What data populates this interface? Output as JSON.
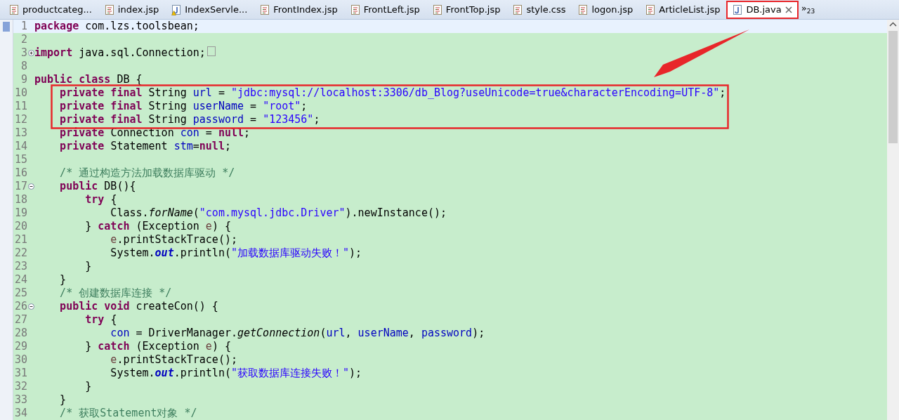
{
  "tabs": [
    {
      "label": "productcateg...",
      "kind": "jsp",
      "warning": false,
      "selected": false
    },
    {
      "label": "index.jsp",
      "kind": "jsp",
      "warning": false,
      "selected": false
    },
    {
      "label": "IndexServle...",
      "kind": "java",
      "warning": true,
      "selected": false
    },
    {
      "label": "FrontIndex.jsp",
      "kind": "jsp",
      "warning": false,
      "selected": false
    },
    {
      "label": "FrontLeft.jsp",
      "kind": "jsp",
      "warning": false,
      "selected": false
    },
    {
      "label": "FrontTop.jsp",
      "kind": "jsp",
      "warning": false,
      "selected": false
    },
    {
      "label": "style.css",
      "kind": "jsp",
      "warning": false,
      "selected": false
    },
    {
      "label": "logon.jsp",
      "kind": "jsp",
      "warning": false,
      "selected": false
    },
    {
      "label": "ArticleList.jsp",
      "kind": "jsp",
      "warning": false,
      "selected": false
    },
    {
      "label": "DB.java",
      "kind": "java",
      "warning": false,
      "selected": true
    }
  ],
  "overflow": {
    "symbol": "»",
    "count": "23"
  },
  "lines": [
    {
      "n": "1",
      "current": true,
      "tokens": [
        {
          "kind": "kw",
          "text": "package "
        },
        {
          "kind": "pl",
          "text": "com.lzs.toolsbean;"
        }
      ]
    },
    {
      "n": "2",
      "current": false
    },
    {
      "n": "3",
      "current": false,
      "folded": true,
      "tokens": [
        {
          "kind": "kw",
          "text": "import "
        },
        {
          "kind": "pl",
          "text": "java.sql.Connection;"
        }
      ]
    },
    {
      "n": "8",
      "current": false
    },
    {
      "n": "9",
      "current": false,
      "tokens": [
        {
          "kind": "kw",
          "text": "public class "
        },
        {
          "kind": "pl",
          "text": "DB {"
        }
      ]
    },
    {
      "n": "10",
      "current": false,
      "tokens": [
        {
          "kind": "kw",
          "text": "    private final "
        },
        {
          "kind": "pl",
          "text": "String "
        },
        {
          "kind": "fd",
          "text": "url"
        },
        {
          "kind": "pl",
          "text": " = "
        },
        {
          "kind": "st",
          "text": "\"jdbc:mysql://localhost:3306/db_Blog?useUnicode=true&characterEncoding=UTF-8\""
        },
        {
          "kind": "pl",
          "text": ";"
        }
      ]
    },
    {
      "n": "11",
      "current": false,
      "tokens": [
        {
          "kind": "kw",
          "text": "    private final "
        },
        {
          "kind": "pl",
          "text": "String "
        },
        {
          "kind": "fd",
          "text": "userName"
        },
        {
          "kind": "pl",
          "text": " = "
        },
        {
          "kind": "st",
          "text": "\"root\""
        },
        {
          "kind": "pl",
          "text": ";"
        }
      ]
    },
    {
      "n": "12",
      "current": false,
      "tokens": [
        {
          "kind": "kw",
          "text": "    private final "
        },
        {
          "kind": "pl",
          "text": "String "
        },
        {
          "kind": "fd",
          "text": "password"
        },
        {
          "kind": "pl",
          "text": " = "
        },
        {
          "kind": "st",
          "text": "\"123456\""
        },
        {
          "kind": "pl",
          "text": ";"
        }
      ]
    },
    {
      "n": "13",
      "current": false,
      "tokens": [
        {
          "kind": "kw",
          "text": "    private "
        },
        {
          "kind": "pl",
          "text": "Connection "
        },
        {
          "kind": "fd",
          "text": "con"
        },
        {
          "kind": "pl",
          "text": " = "
        },
        {
          "kind": "kw",
          "text": "null"
        },
        {
          "kind": "pl",
          "text": ";"
        }
      ]
    },
    {
      "n": "14",
      "current": false,
      "tokens": [
        {
          "kind": "kw",
          "text": "    private "
        },
        {
          "kind": "pl",
          "text": "Statement "
        },
        {
          "kind": "fd",
          "text": "stm"
        },
        {
          "kind": "pl",
          "text": "="
        },
        {
          "kind": "kw",
          "text": "null"
        },
        {
          "kind": "pl",
          "text": ";"
        }
      ]
    },
    {
      "n": "15",
      "current": false
    },
    {
      "n": "16",
      "current": false,
      "tokens": [
        {
          "kind": "cm",
          "text": "    /* 通过构造方法加载数据库驱动 */"
        }
      ]
    },
    {
      "n": "17",
      "current": false,
      "folded": false,
      "tokens": [
        {
          "kind": "kw",
          "text": "    public "
        },
        {
          "kind": "pl",
          "text": "DB(){"
        }
      ]
    },
    {
      "n": "18",
      "current": false,
      "tokens": [
        {
          "kind": "kw",
          "text": "        try "
        },
        {
          "kind": "pl",
          "text": "{"
        }
      ]
    },
    {
      "n": "19",
      "current": false,
      "tokens": [
        {
          "kind": "pl",
          "text": "            Class."
        },
        {
          "kind": "it",
          "text": "forName"
        },
        {
          "kind": "pl",
          "text": "("
        },
        {
          "kind": "st",
          "text": "\"com.mysql.jdbc.Driver\""
        },
        {
          "kind": "pl",
          "text": ").newInstance();"
        }
      ]
    },
    {
      "n": "20",
      "current": false,
      "tokens": [
        {
          "kind": "pl",
          "text": "        } "
        },
        {
          "kind": "kw",
          "text": "catch "
        },
        {
          "kind": "pl",
          "text": "(Exception "
        },
        {
          "kind": "lv",
          "text": "e"
        },
        {
          "kind": "pl",
          "text": ") {"
        }
      ]
    },
    {
      "n": "21",
      "current": false,
      "tokens": [
        {
          "kind": "lv",
          "text": "            e"
        },
        {
          "kind": "pl",
          "text": ".printStackTrace();"
        }
      ]
    },
    {
      "n": "22",
      "current": false,
      "tokens": [
        {
          "kind": "pl",
          "text": "            System."
        },
        {
          "kind": "sf",
          "text": "out"
        },
        {
          "kind": "pl",
          "text": ".println("
        },
        {
          "kind": "st",
          "text": "\"加载数据库驱动失败！\""
        },
        {
          "kind": "pl",
          "text": ");"
        }
      ]
    },
    {
      "n": "23",
      "current": false,
      "tokens": [
        {
          "kind": "pl",
          "text": "        }"
        }
      ]
    },
    {
      "n": "24",
      "current": false,
      "tokens": [
        {
          "kind": "pl",
          "text": "    }"
        }
      ]
    },
    {
      "n": "25",
      "current": false,
      "tokens": [
        {
          "kind": "cm",
          "text": "    /* 创建数据库连接 */"
        }
      ]
    },
    {
      "n": "26",
      "current": false,
      "folded": false,
      "tokens": [
        {
          "kind": "kw",
          "text": "    public void "
        },
        {
          "kind": "pl",
          "text": "createCon() {"
        }
      ]
    },
    {
      "n": "27",
      "current": false,
      "tokens": [
        {
          "kind": "kw",
          "text": "        try "
        },
        {
          "kind": "pl",
          "text": "{"
        }
      ]
    },
    {
      "n": "28",
      "current": false,
      "tokens": [
        {
          "kind": "fd",
          "text": "            con"
        },
        {
          "kind": "pl",
          "text": " = DriverManager."
        },
        {
          "kind": "it",
          "text": "getConnection"
        },
        {
          "kind": "pl",
          "text": "("
        },
        {
          "kind": "fd",
          "text": "url"
        },
        {
          "kind": "pl",
          "text": ", "
        },
        {
          "kind": "fd",
          "text": "userName"
        },
        {
          "kind": "pl",
          "text": ", "
        },
        {
          "kind": "fd",
          "text": "password"
        },
        {
          "kind": "pl",
          "text": ");"
        }
      ]
    },
    {
      "n": "29",
      "current": false,
      "tokens": [
        {
          "kind": "pl",
          "text": "        } "
        },
        {
          "kind": "kw",
          "text": "catch "
        },
        {
          "kind": "pl",
          "text": "(Exception "
        },
        {
          "kind": "lv",
          "text": "e"
        },
        {
          "kind": "pl",
          "text": ") {"
        }
      ]
    },
    {
      "n": "30",
      "current": false,
      "tokens": [
        {
          "kind": "lv",
          "text": "            e"
        },
        {
          "kind": "pl",
          "text": ".printStackTrace();"
        }
      ]
    },
    {
      "n": "31",
      "current": false,
      "tokens": [
        {
          "kind": "pl",
          "text": "            System."
        },
        {
          "kind": "sf",
          "text": "out"
        },
        {
          "kind": "pl",
          "text": ".println("
        },
        {
          "kind": "st",
          "text": "\"获取数据库连接失败！\""
        },
        {
          "kind": "pl",
          "text": ");"
        }
      ]
    },
    {
      "n": "32",
      "current": false,
      "tokens": [
        {
          "kind": "pl",
          "text": "        }"
        }
      ]
    },
    {
      "n": "33",
      "current": false,
      "tokens": [
        {
          "kind": "pl",
          "text": "    }"
        }
      ]
    },
    {
      "n": "34",
      "current": false,
      "tokens": [
        {
          "kind": "cm",
          "text": "    /* 获取Statement对象 */"
        }
      ]
    }
  ]
}
